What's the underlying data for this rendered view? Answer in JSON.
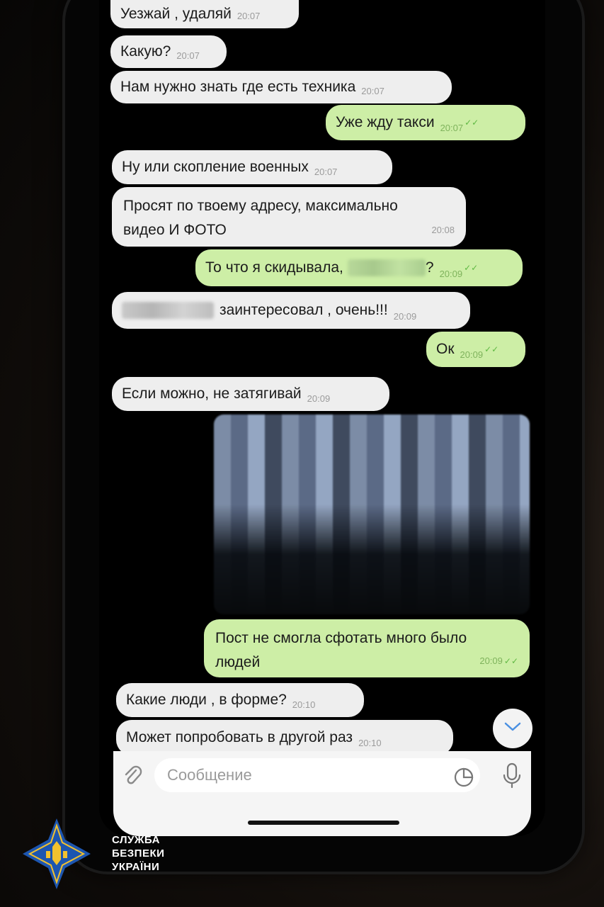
{
  "messages": [
    {
      "dir": "in",
      "text": "Уезжай , удаляй",
      "time": "20:07"
    },
    {
      "dir": "in",
      "text": "Какую?",
      "time": "20:07"
    },
    {
      "dir": "in",
      "text": "Нам нужно знать где есть техника",
      "time": "20:07"
    },
    {
      "dir": "out",
      "text": "Уже жду такси",
      "time": "20:07"
    },
    {
      "dir": "in",
      "text": "Ну или скопление военных",
      "time": "20:07"
    },
    {
      "dir": "in",
      "line1": "Просят по твоему адресу, максимально",
      "line2": "видео И ФОТО",
      "time": "20:08"
    },
    {
      "dir": "out",
      "text_before": "То что я скидывала,",
      "text_after": "?",
      "time": "20:09"
    },
    {
      "dir": "in",
      "text_after": "заинтересовал , очень!!!",
      "time": "20:09"
    },
    {
      "dir": "out",
      "text": "Ок",
      "time": "20:09"
    },
    {
      "dir": "in",
      "text": "Если можно, не затягивай",
      "time": "20:09"
    },
    {
      "dir": "out",
      "line1": "Пост не смогла сфотать много было",
      "line2": "людей",
      "time": "20:09"
    },
    {
      "dir": "in",
      "text": "Какие люди , в форме?",
      "time": "20:10"
    },
    {
      "dir": "in",
      "text": "Может попробовать в другой раз",
      "time": "20:10"
    }
  ],
  "composer": {
    "placeholder": "Сообщение"
  },
  "icons": {
    "attach": "paperclip-icon",
    "sticker": "sticker-icon",
    "mic": "microphone-icon",
    "scroll": "chevron-down-icon"
  },
  "colors": {
    "incoming": "#eeeeee",
    "outgoing": "#cdeea6",
    "check": "#5fb843",
    "logo_blue": "#1d56b0",
    "logo_gold": "#f2c12e"
  },
  "watermark": {
    "line1": "СЛУЖБА",
    "line2": "БЕЗПЕКИ",
    "line3": "УКРАЇНИ"
  }
}
